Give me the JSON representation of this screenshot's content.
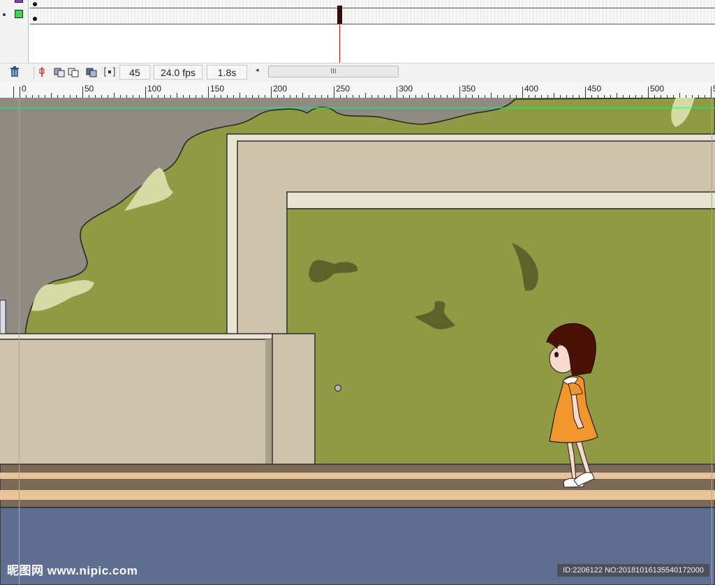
{
  "timeline": {
    "frame_number": "45",
    "fps": "24.0 fps",
    "elapsed": "1.8s",
    "scroll_thumb_glyph": "III",
    "scroll_left_glyph": "◂"
  },
  "ruler": {
    "labels": [
      "0",
      "50",
      "100",
      "150",
      "200",
      "250",
      "300",
      "350",
      "400",
      "450",
      "500",
      "5"
    ]
  },
  "icons": {
    "trash": "trash-icon",
    "onion_center": "center-frame-icon",
    "onion_skin": "onion-skin-icon",
    "onion_outline": "onion-skin-outlines-icon",
    "edit_multiple": "edit-multiple-frames-icon",
    "onion_markers": "modify-onion-markers-icon"
  },
  "watermark": {
    "left": "昵图网 www.nipic.com",
    "right": "ID:2206122 NO:20181016135540172000"
  },
  "colors": {
    "sky_gray": "#8f8a82",
    "foliage": "#8e9a44",
    "foliage_light": "#d4dba4",
    "wall_beige": "#cdc3ab",
    "wall_trim": "#eae5d3",
    "path_brown": "#7b6a5a",
    "path_stripe": "#e8c49a",
    "ground_blue": "#5f6e91",
    "dress_orange": "#f0962c",
    "hair": "#4a1206"
  }
}
